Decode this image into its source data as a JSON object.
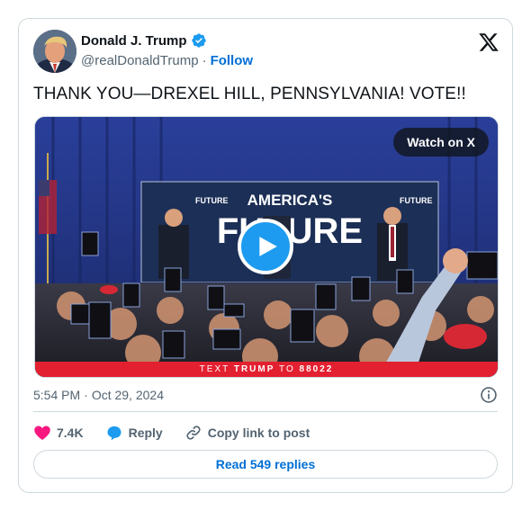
{
  "author": {
    "name": "Donald J. Trump",
    "handle": "@realDonaldTrump",
    "separator": "·",
    "follow_label": "Follow"
  },
  "tweet": {
    "text": "THANK YOU—DREXEL HILL, PENNSYLVANIA! VOTE!!"
  },
  "media": {
    "watch_label": "Watch on X",
    "stage_sign_title": "AMERICA'S",
    "stage_sign_big": "FUTURE",
    "stage_sign_small": "FUTURE",
    "banner_prefix": "TEXT",
    "banner_keyword": "TRUMP",
    "banner_middle": "TO",
    "banner_number": "88022"
  },
  "meta": {
    "time": "5:54 PM",
    "separator": "·",
    "date": "Oct 29, 2024"
  },
  "actions": {
    "likes": "7.4K",
    "reply_label": "Reply",
    "copy_label": "Copy link to post"
  },
  "read_replies_label": "Read 549 replies",
  "colors": {
    "accent_blue": "#1d9bf0",
    "link_blue": "#006fd6",
    "like_pink": "#f91880",
    "banner_red": "#e32030"
  },
  "icons": [
    "verified-badge-icon",
    "x-logo-icon",
    "play-icon",
    "info-icon",
    "heart-icon",
    "reply-bubble-icon",
    "link-icon"
  ]
}
